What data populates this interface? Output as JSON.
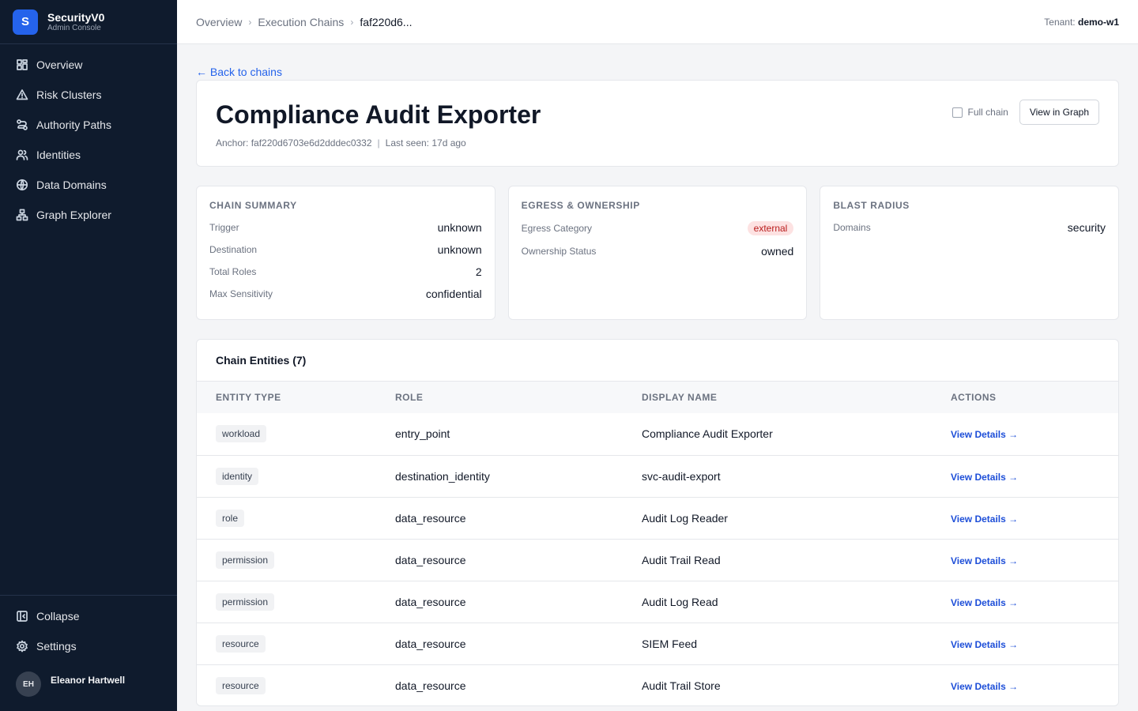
{
  "brand": {
    "logo_letter": "S",
    "name": "SecurityV0",
    "subtitle": "Admin Console"
  },
  "sidebar": {
    "items": [
      {
        "label": "Overview",
        "icon": "grid-icon"
      },
      {
        "label": "Risk Clusters",
        "icon": "warning-triangle-icon"
      },
      {
        "label": "Authority Paths",
        "icon": "route-icon"
      },
      {
        "label": "Identities",
        "icon": "users-icon"
      },
      {
        "label": "Data Domains",
        "icon": "globe-icon"
      },
      {
        "label": "Graph Explorer",
        "icon": "graph-icon"
      }
    ],
    "bottom": [
      {
        "label": "Collapse",
        "icon": "collapse-panel-icon"
      },
      {
        "label": "Settings",
        "icon": "gear-icon"
      }
    ],
    "user": {
      "initials": "EH",
      "name": "Eleanor Hartwell"
    }
  },
  "header": {
    "breadcrumbs": [
      "Overview",
      "Execution Chains",
      "faf220d6..."
    ],
    "tenant_label": "Tenant:",
    "tenant_value": "demo-w1"
  },
  "page": {
    "back_link": "← Back to chains",
    "title": "Compliance Audit Exporter",
    "anchor": "Anchor: faf220d6703e6d2dddec0332",
    "last_seen": "Last seen: 17d ago",
    "full_chain_label": "Full chain",
    "full_chain_checked": false,
    "view_graph_label": "View in Graph"
  },
  "chain_summary": {
    "title": "CHAIN SUMMARY",
    "rows": [
      {
        "key": "Trigger",
        "value": "unknown"
      },
      {
        "key": "Destination",
        "value": "unknown"
      },
      {
        "key": "Total Roles",
        "value": "2"
      },
      {
        "key": "Max Sensitivity",
        "value": "confidential"
      }
    ]
  },
  "egress": {
    "title": "EGRESS & OWNERSHIP",
    "egress_key": "Egress Category",
    "egress_value": "external",
    "ownership_key": "Ownership Status",
    "ownership_value": "owned",
    "badge_color": "#fde2e2"
  },
  "blast_radius": {
    "title": "BLAST RADIUS",
    "domains_key": "Domains",
    "domains_value": "security"
  },
  "entities": {
    "title": "Chain Entities (7)",
    "columns": [
      "ENTITY TYPE",
      "ROLE",
      "DISPLAY NAME",
      "ACTIONS"
    ],
    "rows": [
      {
        "type": "workload",
        "role": "entry_point",
        "name": "Compliance Audit Exporter",
        "action": "View Details →"
      },
      {
        "type": "identity",
        "role": "destination_identity",
        "name": "svc-audit-export",
        "action": "View Details →"
      },
      {
        "type": "role",
        "role": "data_resource",
        "name": "Audit Log Reader",
        "action": "View Details →"
      },
      {
        "type": "permission",
        "role": "data_resource",
        "name": "Audit Trail Read",
        "action": "View Details →"
      },
      {
        "type": "permission",
        "role": "data_resource",
        "name": "Audit Log Read",
        "action": "View Details →"
      },
      {
        "type": "resource",
        "role": "data_resource",
        "name": "SIEM Feed",
        "action": "View Details →"
      },
      {
        "type": "resource",
        "role": "data_resource",
        "name": "Audit Trail Store",
        "action": "View Details →"
      }
    ]
  },
  "colors": {
    "sidebar_bg": "#0f1b2d",
    "accent": "#2563eb",
    "link": "#1d4ed8"
  }
}
